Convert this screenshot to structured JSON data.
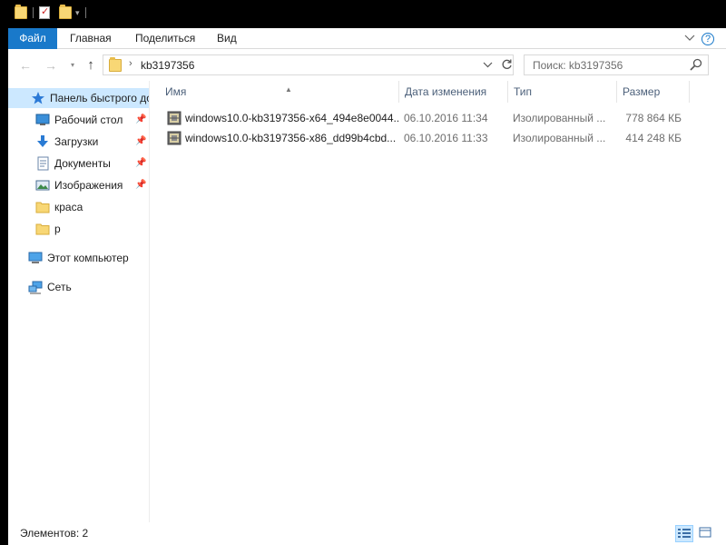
{
  "titlebar": {
    "qat_icons": [
      "folder-icon",
      "properties-icon",
      "new-folder-icon",
      "dropdown-icon"
    ]
  },
  "ribbon": {
    "tabs": [
      {
        "label": "Файл"
      },
      {
        "label": "Главная"
      },
      {
        "label": "Поделиться"
      },
      {
        "label": "Вид"
      }
    ],
    "expand_icon": "chevron-down-icon",
    "help_icon": "help-icon",
    "help_glyph": "?",
    "accent": "#1979ca"
  },
  "navbar": {
    "back_glyph": "←",
    "forward_glyph": "→",
    "recent_glyph": "▾",
    "up_glyph": "↑",
    "path_separator": "›",
    "path": "kb3197356",
    "search_placeholder": "Поиск: kb3197356"
  },
  "nav_pane": {
    "items": [
      {
        "label": "Панель быстрого доступа",
        "icon": "star-icon",
        "pinned": false,
        "selected": true
      },
      {
        "label": "Рабочий стол",
        "icon": "desktop-icon",
        "pinned": true
      },
      {
        "label": "Загрузки",
        "icon": "download-icon",
        "pinned": true
      },
      {
        "label": "Документы",
        "icon": "documents-icon",
        "pinned": true
      },
      {
        "label": "Изображения",
        "icon": "pictures-icon",
        "pinned": true
      },
      {
        "label": "краса",
        "icon": "folder-icon",
        "pinned": false
      },
      {
        "label": "р",
        "icon": "folder-icon",
        "pinned": false
      },
      {
        "label": "Этот компьютер",
        "icon": "computer-icon",
        "pinned": false
      },
      {
        "label": "Сеть",
        "icon": "network-icon",
        "pinned": false
      }
    ],
    "pin_glyph": "📌",
    "selection_color": "#cce8ff"
  },
  "file_list": {
    "columns": [
      {
        "label": "Имя"
      },
      {
        "label": "Дата изменения"
      },
      {
        "label": "Тип"
      },
      {
        "label": "Размер"
      }
    ],
    "sort_glyph": "▲",
    "files": [
      {
        "name": "windows10.0-kb3197356-x64_494e8e0044...",
        "date": "06.10.2016 11:34",
        "type": "Изолированный ...",
        "size": "778 864 КБ",
        "icon": "msu-package-icon"
      },
      {
        "name": "windows10.0-kb3197356-x86_dd99b4cbd...",
        "date": "06.10.2016 11:33",
        "type": "Изолированный ...",
        "size": "414 248 КБ",
        "icon": "msu-package-icon"
      }
    ]
  },
  "statusbar": {
    "item_count": "Элементов: 2",
    "views": [
      {
        "icon": "details-view-icon",
        "active": true
      },
      {
        "icon": "large-icons-view-icon",
        "active": false
      }
    ]
  }
}
